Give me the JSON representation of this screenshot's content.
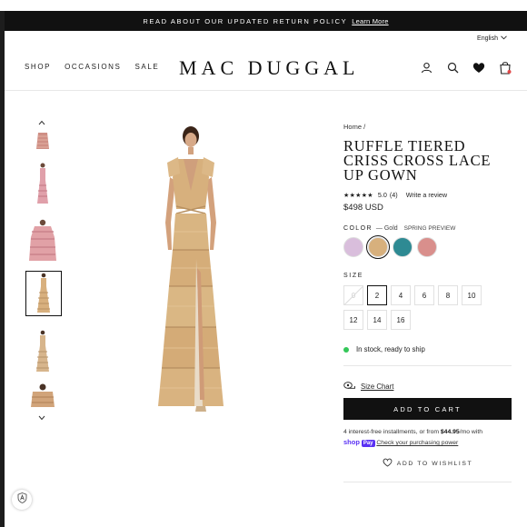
{
  "announcement": {
    "text": "READ ABOUT OUR UPDATED RETURN POLICY",
    "link": "Learn More"
  },
  "language": {
    "label": "English"
  },
  "nav": {
    "items": [
      {
        "label": "SHOP"
      },
      {
        "label": "OCCASIONS"
      },
      {
        "label": "SALE"
      }
    ]
  },
  "brand": {
    "logo": "MAC DUGGAL"
  },
  "header_icons": [
    "user-icon",
    "search-icon",
    "heart-icon",
    "cart-bag-icon"
  ],
  "gallery": {
    "thumbnail_count": 7,
    "active_index": 3,
    "thumb_colors": [
      "#d7b08a",
      "#cf8f8f",
      "#e1a1a6",
      "#d8b07e",
      "#d7b58c",
      "#d1a47a"
    ]
  },
  "product": {
    "breadcrumb": "Home /",
    "title": "RUFFLE TIERED CRISS CROSS LACE UP GOWN",
    "stars": "★★★★★",
    "rating": "5.0",
    "review_count": "(4)",
    "write_review": "Write a review",
    "price": "$498 USD",
    "color_label": "COLOR",
    "color_selected": "— Gold",
    "color_collection": "SPRING PREVIEW",
    "swatches": [
      {
        "name": "lilac",
        "color": "#d9bedc"
      },
      {
        "name": "gold",
        "color": "#d7b07d",
        "active": true
      },
      {
        "name": "teal",
        "color": "#2e8a93"
      },
      {
        "name": "rose",
        "color": "#d98f8c"
      }
    ],
    "size_label": "SIZE",
    "sizes": [
      {
        "label": "0",
        "state": "unavailable"
      },
      {
        "label": "2",
        "state": "selected"
      },
      {
        "label": "4",
        "state": "available"
      },
      {
        "label": "6",
        "state": "available"
      },
      {
        "label": "8",
        "state": "available"
      },
      {
        "label": "10",
        "state": "available"
      },
      {
        "label": "12",
        "state": "available"
      },
      {
        "label": "14",
        "state": "available"
      },
      {
        "label": "16",
        "state": "available"
      }
    ],
    "stock": "In stock, ready to ship",
    "size_chart": "Size Chart",
    "add_to_cart": "ADD TO CART",
    "installments_a": "4 interest-free installments, or from",
    "installments_amount": "$44.95",
    "installments_b": "/mo with",
    "shop_word": "shop",
    "pay_word": "Pay",
    "check_power": "Check your purchasing power",
    "wishlist": "ADD TO WISHLIST"
  },
  "colors": {
    "accent": "#111111",
    "in_stock": "#34c759",
    "shop_pay": "#5a31f4"
  }
}
